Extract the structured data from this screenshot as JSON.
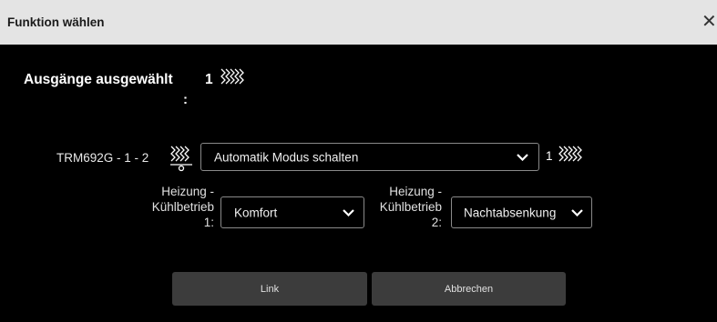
{
  "dialog": {
    "title": "Funktion wählen",
    "close_label": "✕"
  },
  "selected_outputs": {
    "label": "Ausgänge ausgewählt",
    "colon": ":",
    "count": "1",
    "icon": "heating-waves-icon"
  },
  "device": {
    "label": "TRM692G - 1 - 2",
    "icon": "floor-heating-valve-icon",
    "mode_select_value": "Automatik Modus schalten",
    "count": "1",
    "count_icon": "heating-waves-icon"
  },
  "heating_cooling_1": {
    "label_line1": "Heizung -",
    "label_line2": "Kühlbetrieb",
    "label_line3": "1:",
    "value": "Komfort"
  },
  "heating_cooling_2": {
    "label_line1": "Heizung -",
    "label_line2": "Kühlbetrieb",
    "label_line3": "2:",
    "value": "Nachtabsenkung"
  },
  "buttons": {
    "link": "Link",
    "cancel": "Abbrechen"
  },
  "colors": {
    "background": "#000000",
    "titlebar": "#e4e4e4",
    "button": "#3c3c3c",
    "border": "#8a8a8a"
  }
}
